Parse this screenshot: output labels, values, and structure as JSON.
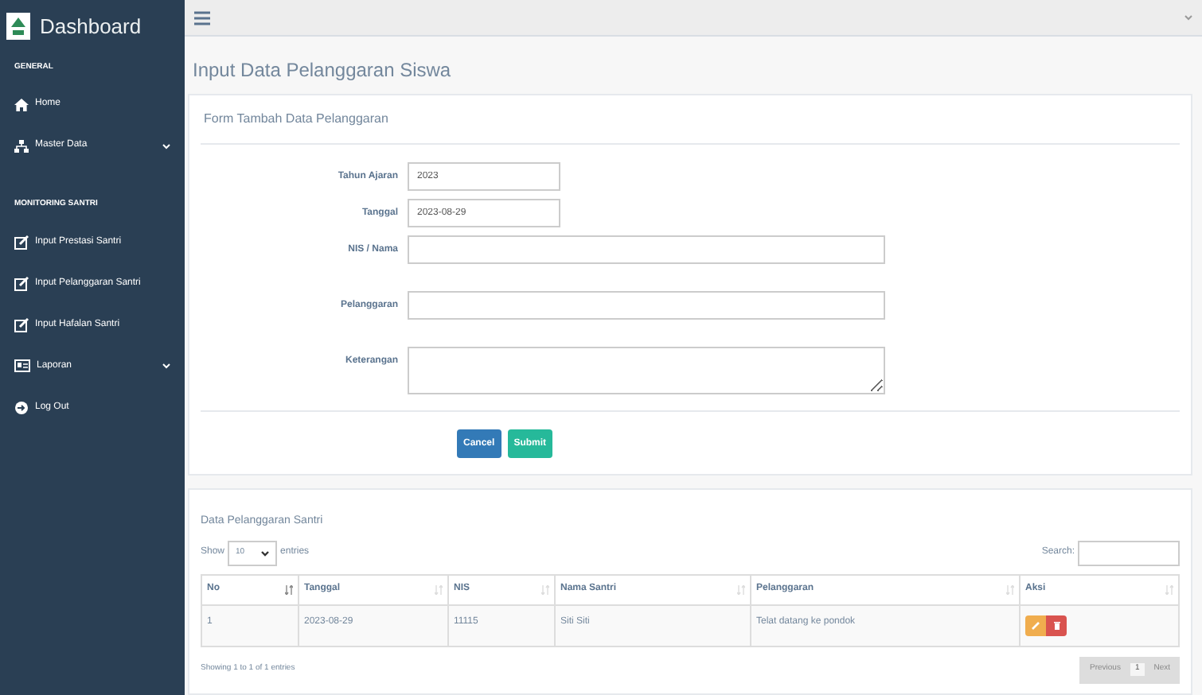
{
  "sidebar": {
    "title": "Dashboard",
    "sections": [
      {
        "heading": "GENERAL",
        "items": [
          {
            "label": "Home",
            "kind": "home",
            "expandable": false
          },
          {
            "label": "Master Data",
            "kind": "sitemap",
            "expandable": true
          }
        ]
      },
      {
        "heading": "MONITORING SANTRI",
        "items": [
          {
            "label": "Input Prestasi Santri",
            "kind": "edit",
            "expandable": false
          },
          {
            "label": "Input Pelanggaran Santri",
            "kind": "edit",
            "expandable": false
          },
          {
            "label": "Input Hafalan Santri",
            "kind": "edit",
            "expandable": false
          },
          {
            "label": "Laporan",
            "kind": "card",
            "expandable": true
          },
          {
            "label": "Log Out",
            "kind": "logout",
            "expandable": false
          }
        ]
      }
    ]
  },
  "page_title": "Input Data Pelanggaran Siswa",
  "form": {
    "title": "Form Tambah Data Pelanggaran",
    "fields": [
      {
        "label": "Tahun Ajaran",
        "kind": "short",
        "value": "2023"
      },
      {
        "label": "Tanggal",
        "kind": "short",
        "value": "2023-08-29"
      },
      {
        "label": "NIS / Nama",
        "kind": "long"
      },
      {
        "label": "Pelanggaran",
        "kind": "long"
      },
      {
        "label": "Keterangan",
        "kind": "textarea"
      }
    ],
    "buttons": [
      {
        "label": "Cancel",
        "kind": "cancel"
      },
      {
        "label": "Submit",
        "kind": "submit"
      }
    ]
  },
  "table_panel": {
    "title": "Data Pelanggaran Santri",
    "show_label": "Show",
    "page_size": "10",
    "entries_label": "entries",
    "search_label": "Search:",
    "columns": [
      {
        "label": "No",
        "sorted": true
      },
      {
        "label": "Tanggal",
        "sorted": false
      },
      {
        "label": "NIS",
        "sorted": false
      },
      {
        "label": "Nama Santri",
        "sorted": false
      },
      {
        "label": "Pelanggaran",
        "sorted": false
      },
      {
        "label": "Aksi",
        "sorted": false
      }
    ],
    "rows": [
      {
        "cells": [
          "1",
          "2023-08-29",
          "11115",
          "Siti Siti",
          "Telat datang ke pondok"
        ]
      }
    ],
    "info": "Showing 1 to 1 of 1 entries",
    "pagination": [
      {
        "label": "Previous",
        "selected": false
      },
      {
        "label": "1",
        "selected": true
      },
      {
        "label": "Next",
        "selected": false
      }
    ]
  }
}
